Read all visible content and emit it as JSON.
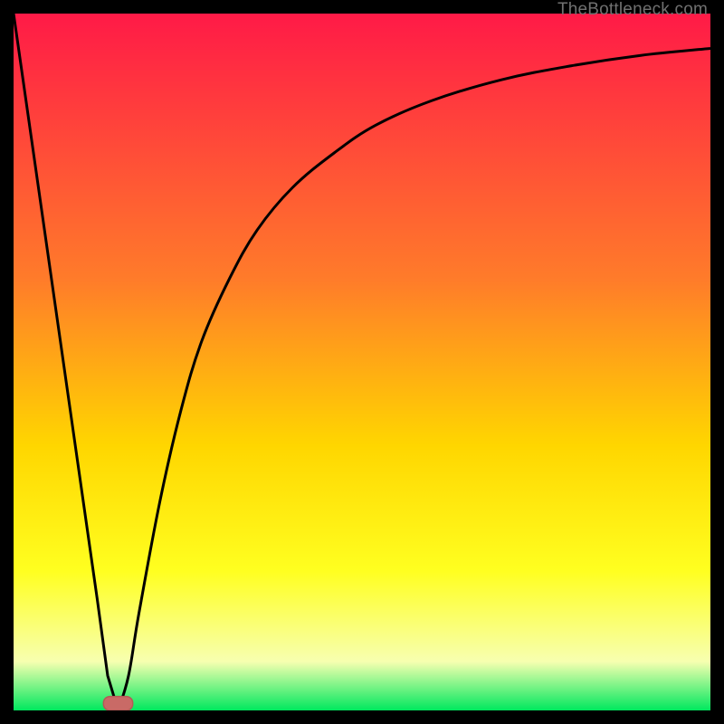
{
  "watermark": "TheBottleneck.com",
  "colors": {
    "gradient_top": "#ff1a47",
    "gradient_mid1": "#ff7b2a",
    "gradient_mid2": "#ffd600",
    "gradient_mid3": "#ffff20",
    "gradient_low": "#f7ffb0",
    "gradient_bottom": "#00e85e",
    "curve": "#000000",
    "marker": "#c96a66",
    "marker_stroke": "#b55a56"
  },
  "chart_data": {
    "type": "line",
    "title": "",
    "xlabel": "",
    "ylabel": "",
    "xlim": [
      0,
      100
    ],
    "ylim": [
      0,
      100
    ],
    "legend": false,
    "grid": false,
    "series": [
      {
        "name": "bottleneck-curve",
        "x": [
          0,
          3,
          6,
          9,
          12,
          13.5,
          15,
          16.5,
          18,
          21,
          24,
          27,
          31,
          35,
          40,
          46,
          52,
          60,
          70,
          80,
          90,
          100
        ],
        "values": [
          100,
          79,
          58,
          37,
          16,
          5,
          0,
          5,
          14,
          30,
          43,
          53,
          62,
          69,
          75,
          80,
          84,
          87.5,
          90.5,
          92.5,
          94,
          95
        ]
      }
    ],
    "annotations": [
      {
        "name": "optimal-marker",
        "x": 15,
        "y": 0,
        "shape": "rounded-rect",
        "w": 4.2,
        "h": 2.0
      }
    ]
  }
}
